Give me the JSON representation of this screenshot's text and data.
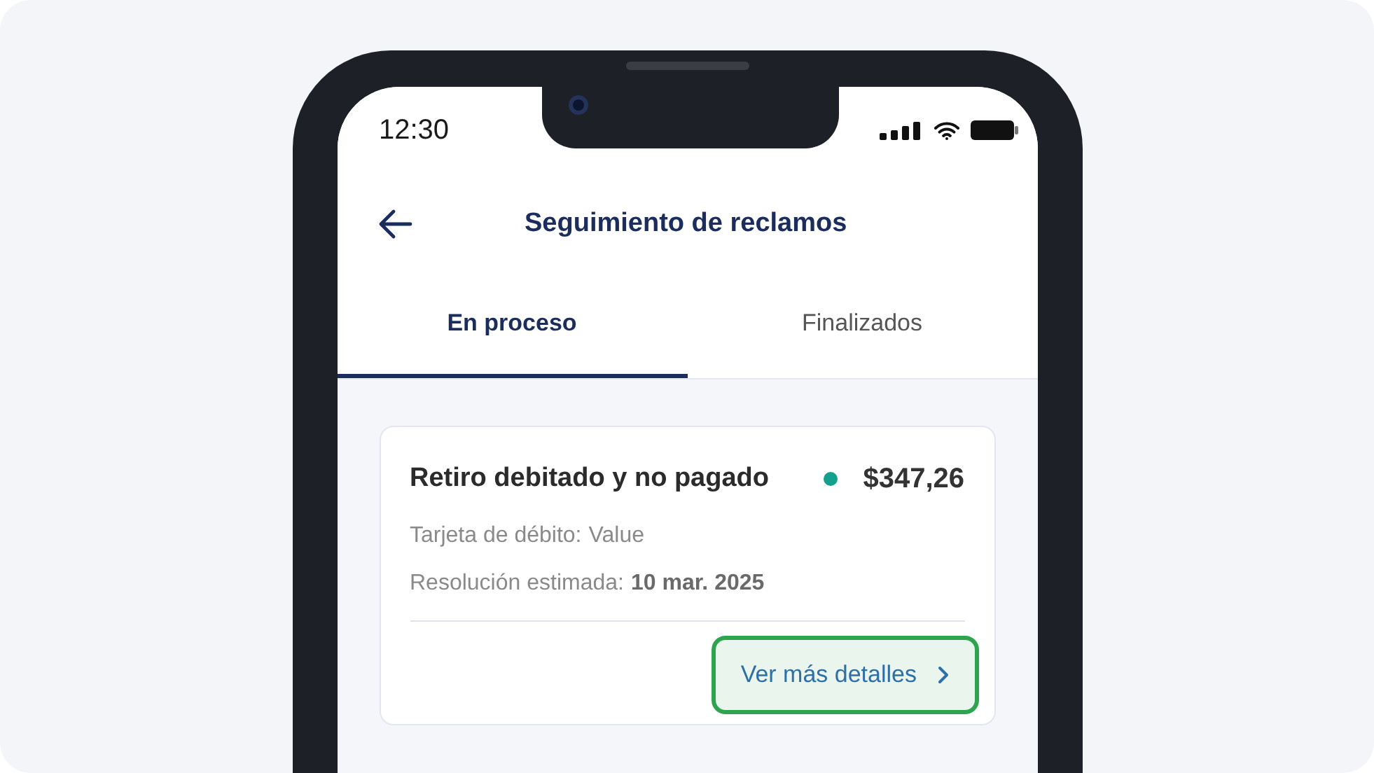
{
  "status_bar": {
    "time": "12:30"
  },
  "header": {
    "title": "Seguimiento de reclamos"
  },
  "tabs": [
    {
      "label": "En proceso",
      "selected": true
    },
    {
      "label": "Finalizados",
      "selected": false
    }
  ],
  "claims": [
    {
      "title": "Retiro debitado y no pagado",
      "color": "#13a08d",
      "amount": "$347,26",
      "card_label": "Tarjeta de débito:",
      "card_value": "Value",
      "resolution_label": "Resolución estimada:",
      "resolution_date": "10 mar. 2025",
      "action": "Ver más detalles"
    }
  ]
}
